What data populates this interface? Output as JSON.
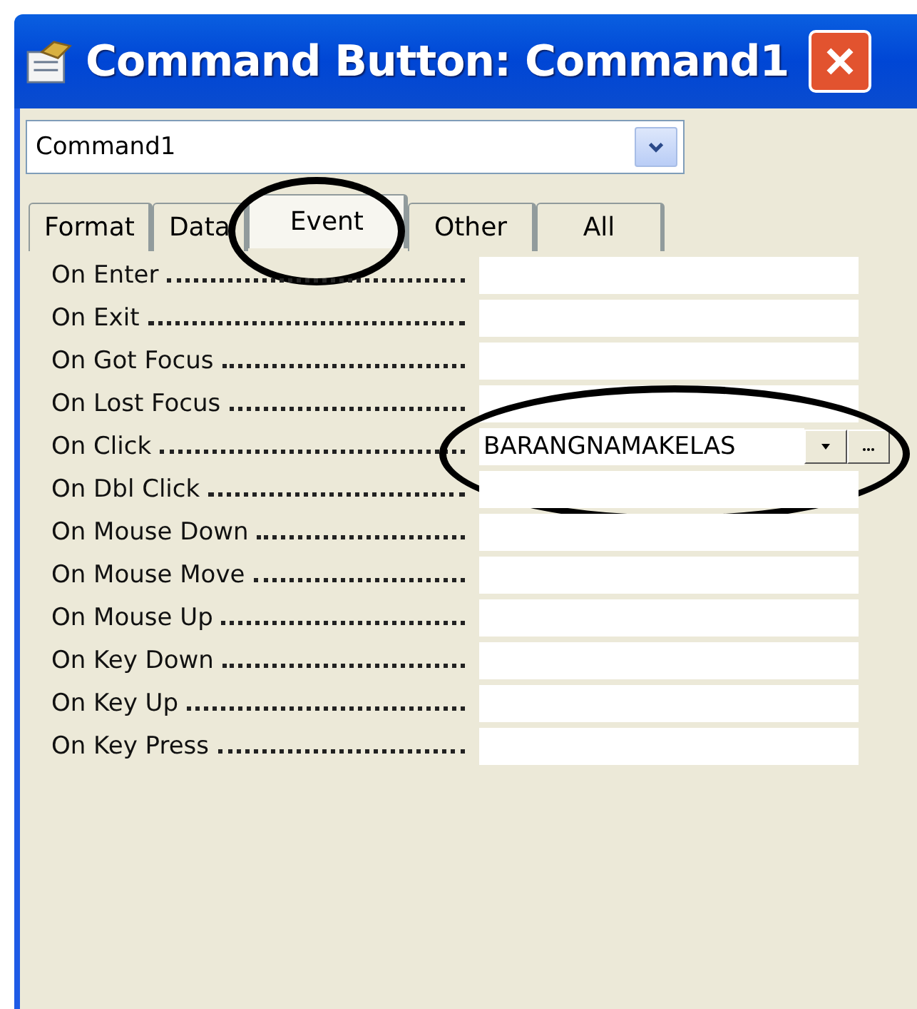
{
  "window": {
    "title": "Command Button: Command1"
  },
  "object_selector": {
    "value": "Command1"
  },
  "tabs": [
    {
      "label": "Format",
      "selected": false,
      "circled": false
    },
    {
      "label": "Data",
      "selected": false,
      "circled": false
    },
    {
      "label": "Event",
      "selected": true,
      "circled": true
    },
    {
      "label": "Other",
      "selected": false,
      "circled": false
    },
    {
      "label": "All",
      "selected": false,
      "circled": false
    }
  ],
  "properties": [
    {
      "name": "On Enter",
      "selected": false,
      "circled": false
    },
    {
      "name": "On Exit",
      "selected": false,
      "circled": false
    },
    {
      "name": "On Got Focus",
      "selected": false,
      "circled": false
    },
    {
      "name": "On Lost Focus",
      "selected": false,
      "circled": false
    },
    {
      "name": "On Click",
      "value": "BARANGNAMAKELAS",
      "selected": true,
      "circled": true
    },
    {
      "name": "On Dbl Click",
      "selected": false,
      "circled": false
    },
    {
      "name": "On Mouse Down",
      "selected": false,
      "circled": false
    },
    {
      "name": "On Mouse Move",
      "selected": false,
      "circled": false
    },
    {
      "name": "On Mouse Up",
      "selected": false,
      "circled": false
    },
    {
      "name": "On Key Down",
      "selected": false,
      "circled": false
    },
    {
      "name": "On Key Up",
      "selected": false,
      "circled": false
    },
    {
      "name": "On Key Press",
      "selected": false,
      "circled": false
    }
  ]
}
